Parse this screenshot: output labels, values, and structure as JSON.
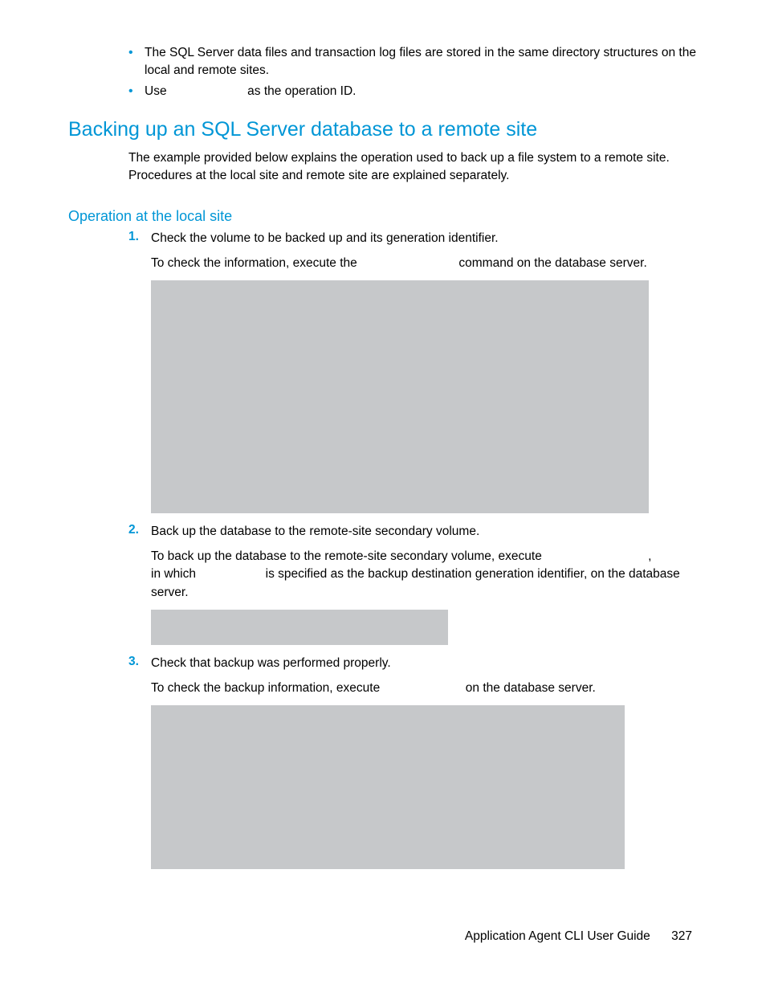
{
  "bullets": {
    "b1": "The SQL Server data files and transaction log files are stored in the same directory structures on the local and remote sites.",
    "b2_pre": "Use ",
    "b2_post": " as the operation ID."
  },
  "heading_main": "Backing up an SQL Server database to a remote site",
  "intro": "The example provided below explains the operation used to back up a file system to a remote site. Procedures at the local site and remote site are explained separately.",
  "subheading": "Operation at the local site",
  "steps": {
    "s1_title": "Check the volume to be backed up and its generation identifier.",
    "s1_body_pre": "To check the information, execute the ",
    "s1_body_post": " command on the database server.",
    "s2_title": "Back up the database to the remote-site secondary volume.",
    "s2_body_1_pre": "To back up the database to the remote-site secondary volume, execute ",
    "s2_body_1_post": ",",
    "s2_body_2_pre": "in which ",
    "s2_body_2_mid": " is specified as the backup destination generation identifier, on the database",
    "s2_body_3": "server.",
    "s3_title": "Check that backup was performed properly.",
    "s3_body_pre": "To check the backup information, execute ",
    "s3_body_post": " on the database server."
  },
  "footer": {
    "title": "Application Agent CLI User Guide",
    "page_number": "327"
  }
}
